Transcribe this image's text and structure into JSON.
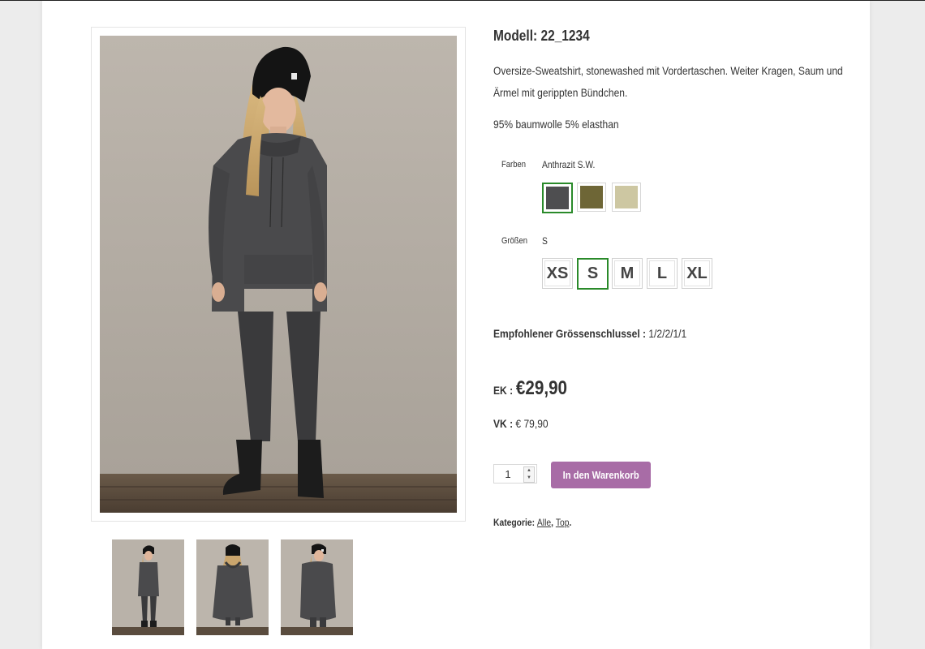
{
  "product": {
    "model": "Modell: 22_1234",
    "description": "Oversize-Sweatshirt, stonewashed mit Vordertaschen. Weiter Kragen, Saum und Ärmel mit gerippten Bündchen.",
    "material": "95% baumwolle 5% elasthan"
  },
  "colors": {
    "label": "Farben",
    "selected_value": "Anthrazit S.W.",
    "swatches": [
      {
        "name": "anthrazit",
        "hex": "#4e4e50",
        "selected": true
      },
      {
        "name": "olive",
        "hex": "#6e6636",
        "selected": false
      },
      {
        "name": "beige",
        "hex": "#cdc7a2",
        "selected": false
      }
    ]
  },
  "sizes": {
    "label": "Größen",
    "selected_value": "S",
    "options": [
      "XS",
      "S",
      "M",
      "L",
      "XL"
    ]
  },
  "size_key": {
    "label": "Empfohlener Grössenschlussel :",
    "value": "1/2/2/1/1"
  },
  "price": {
    "ek_label": "EK :",
    "ek_value": "€29,90",
    "vk_label": "VK :",
    "vk_value": "€ 79,90"
  },
  "cart": {
    "quantity": "1",
    "button_label": "In den Warenkorb"
  },
  "category": {
    "label": "Kategorie:",
    "links": [
      "Alle",
      "Top"
    ],
    "sep": ", ",
    "end": "."
  },
  "colors_theme": {
    "accent_button": "#a86ca6",
    "selected_border": "#2a8a2a"
  }
}
